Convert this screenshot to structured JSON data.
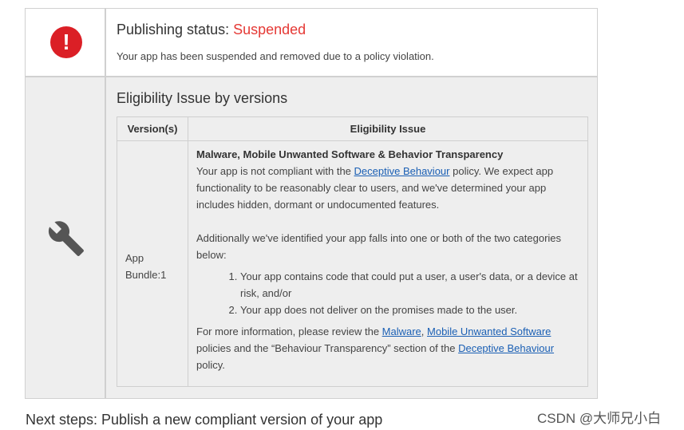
{
  "status": {
    "label": "Publishing status: ",
    "value": "Suspended",
    "description": "Your app has been suspended and removed due to a policy violation.",
    "icon": "alert-circle-icon",
    "icon_glyph": "!",
    "colors": {
      "suspended": "#e53935",
      "icon_bg": "#db1f26",
      "link": "#1a5fb4"
    }
  },
  "eligibility": {
    "title": "Eligibility Issue by versions",
    "icon": "wrench-icon",
    "columns": [
      "Version(s)",
      "Eligibility Issue"
    ],
    "version": [
      "App",
      "Bundle:1"
    ],
    "issue_title": "Malware, Mobile Unwanted Software & Behavior Transparency",
    "p1_before": "Your app is not compliant with the ",
    "p1_link": "Deceptive Behaviour",
    "p1_after": " policy. We expect app functionality to be reasonably clear to users, and we've determined your app includes hidden, dormant or undocumented features.",
    "p2": "Additionally we've identified your app falls into one or both of the two categories below:",
    "list": [
      "Your app contains code that could put a user, a user's data, or a device at risk, and/or",
      "Your app does not deliver on the promises made to the user."
    ],
    "p3_before": "For more information, please review the ",
    "p3_link1": "Malware",
    "p3_sep": ", ",
    "p3_link2": "Mobile Unwanted Software",
    "p3_mid": " policies and the “Behaviour Transparency” section of the ",
    "p3_link3": "Deceptive Behaviour",
    "p3_end": " policy."
  },
  "next_steps": "Next steps: Publish a new compliant version of your app",
  "watermark": "CSDN @大师兄小白"
}
